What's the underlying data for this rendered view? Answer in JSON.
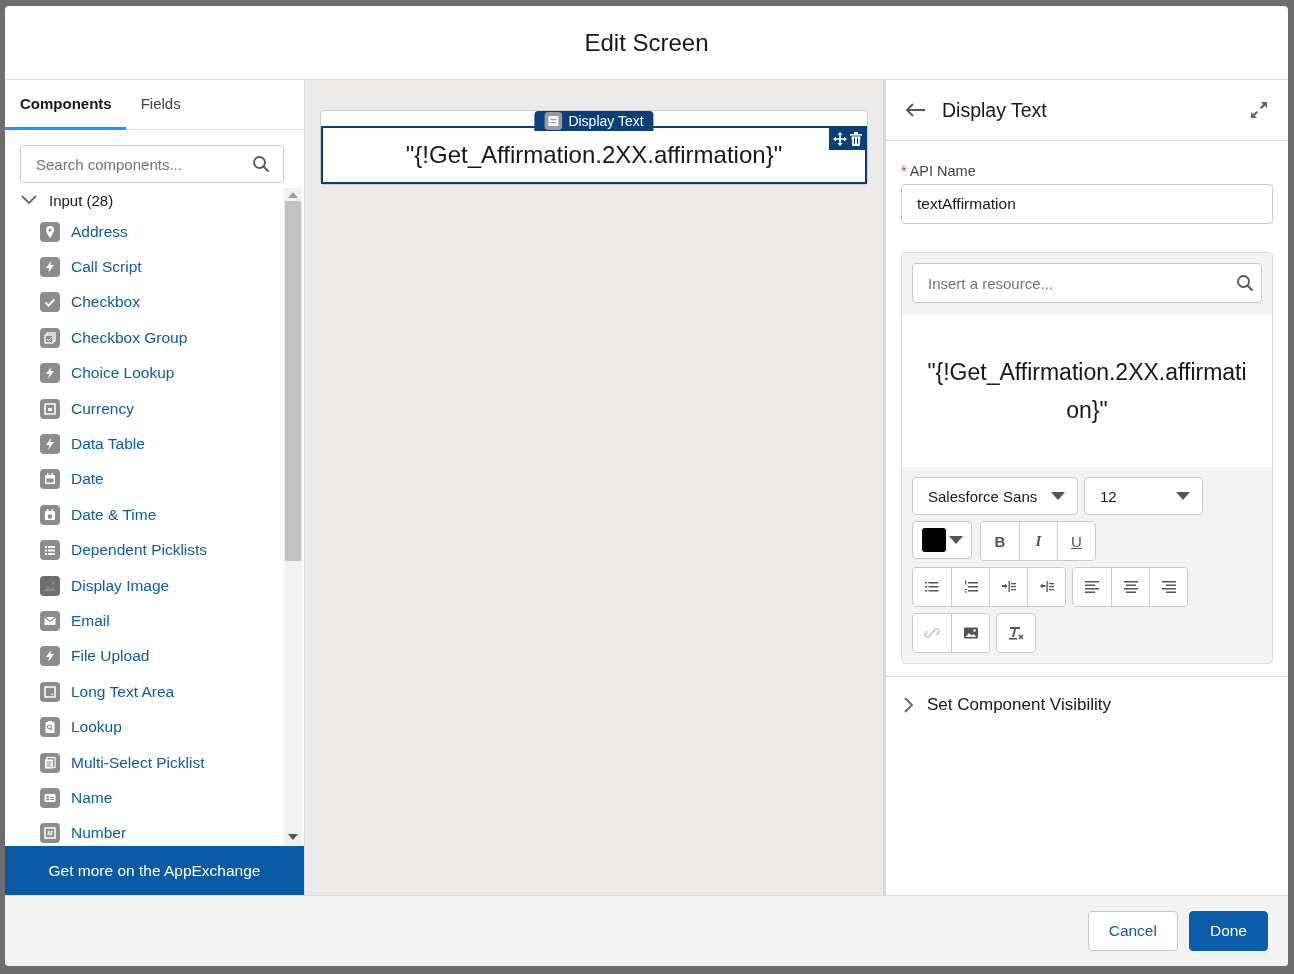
{
  "window": {
    "title": "Edit Screen"
  },
  "left_panel": {
    "tabs": [
      {
        "label": "Components",
        "selected": true
      },
      {
        "label": "Fields",
        "selected": false
      }
    ],
    "search": {
      "placeholder": "Search components..."
    },
    "groups": [
      {
        "label": "Input (28)",
        "expanded": true,
        "items": [
          {
            "label": "Address",
            "kind": "pin"
          },
          {
            "label": "Call Script",
            "kind": "bolt"
          },
          {
            "label": "Checkbox",
            "kind": "check"
          },
          {
            "label": "Checkbox Group",
            "kind": "checkgroup"
          },
          {
            "label": "Choice Lookup",
            "kind": "bolt"
          },
          {
            "label": "Currency",
            "kind": "frame"
          },
          {
            "label": "Data Table",
            "kind": "bolt"
          },
          {
            "label": "Date",
            "kind": "calendar"
          },
          {
            "label": "Date & Time",
            "kind": "calendar-clock"
          },
          {
            "label": "Dependent Picklists",
            "kind": "list"
          },
          {
            "label": "Display Image",
            "kind": "image"
          },
          {
            "label": "Email",
            "kind": "email"
          },
          {
            "label": "File Upload",
            "kind": "bolt"
          },
          {
            "label": "Long Text Area",
            "kind": "textarea"
          },
          {
            "label": "Lookup",
            "kind": "lookup"
          },
          {
            "label": "Multi-Select Picklist",
            "kind": "multi"
          },
          {
            "label": "Name",
            "kind": "name"
          },
          {
            "label": "Number",
            "kind": "number"
          }
        ]
      }
    ],
    "appexchange_button": "Get more on the AppExchange"
  },
  "canvas": {
    "component": {
      "type_label": "Display Text",
      "text": "\"{!Get_Affirmation.2XX.affirmation}\"",
      "selected": true
    }
  },
  "properties": {
    "title": "Display Text",
    "api_name": {
      "required_mark": "*",
      "label": "API Name",
      "value": "textAffirmation"
    },
    "resource_search": {
      "placeholder": "Insert a resource..."
    },
    "editor_text": "\"{!Get_Affirmation.2XX.affirmation}\"",
    "font": "Salesforce Sans",
    "size": "12",
    "text_color": {
      "color": "#000000"
    },
    "format_buttons": [
      {
        "label": "B",
        "kind": "bold"
      },
      {
        "label": "I",
        "kind": "italic"
      },
      {
        "label": "U",
        "kind": "underline"
      }
    ],
    "list_buttons": [
      {
        "kind": "bullets"
      },
      {
        "kind": "numbers"
      },
      {
        "kind": "indent"
      },
      {
        "kind": "outdent"
      }
    ],
    "align_buttons": [
      {
        "kind": "left"
      },
      {
        "kind": "center"
      },
      {
        "kind": "right"
      }
    ],
    "insert_buttons": [
      {
        "kind": "link",
        "disabled": true
      },
      {
        "kind": "image",
        "disabled": false
      }
    ],
    "visibility": {
      "label": "Set Component Visibility",
      "expanded": false
    }
  },
  "footer": {
    "buttons": [
      {
        "label": "Cancel",
        "kind": "neutral"
      },
      {
        "label": "Done",
        "kind": "brand"
      }
    ]
  }
}
